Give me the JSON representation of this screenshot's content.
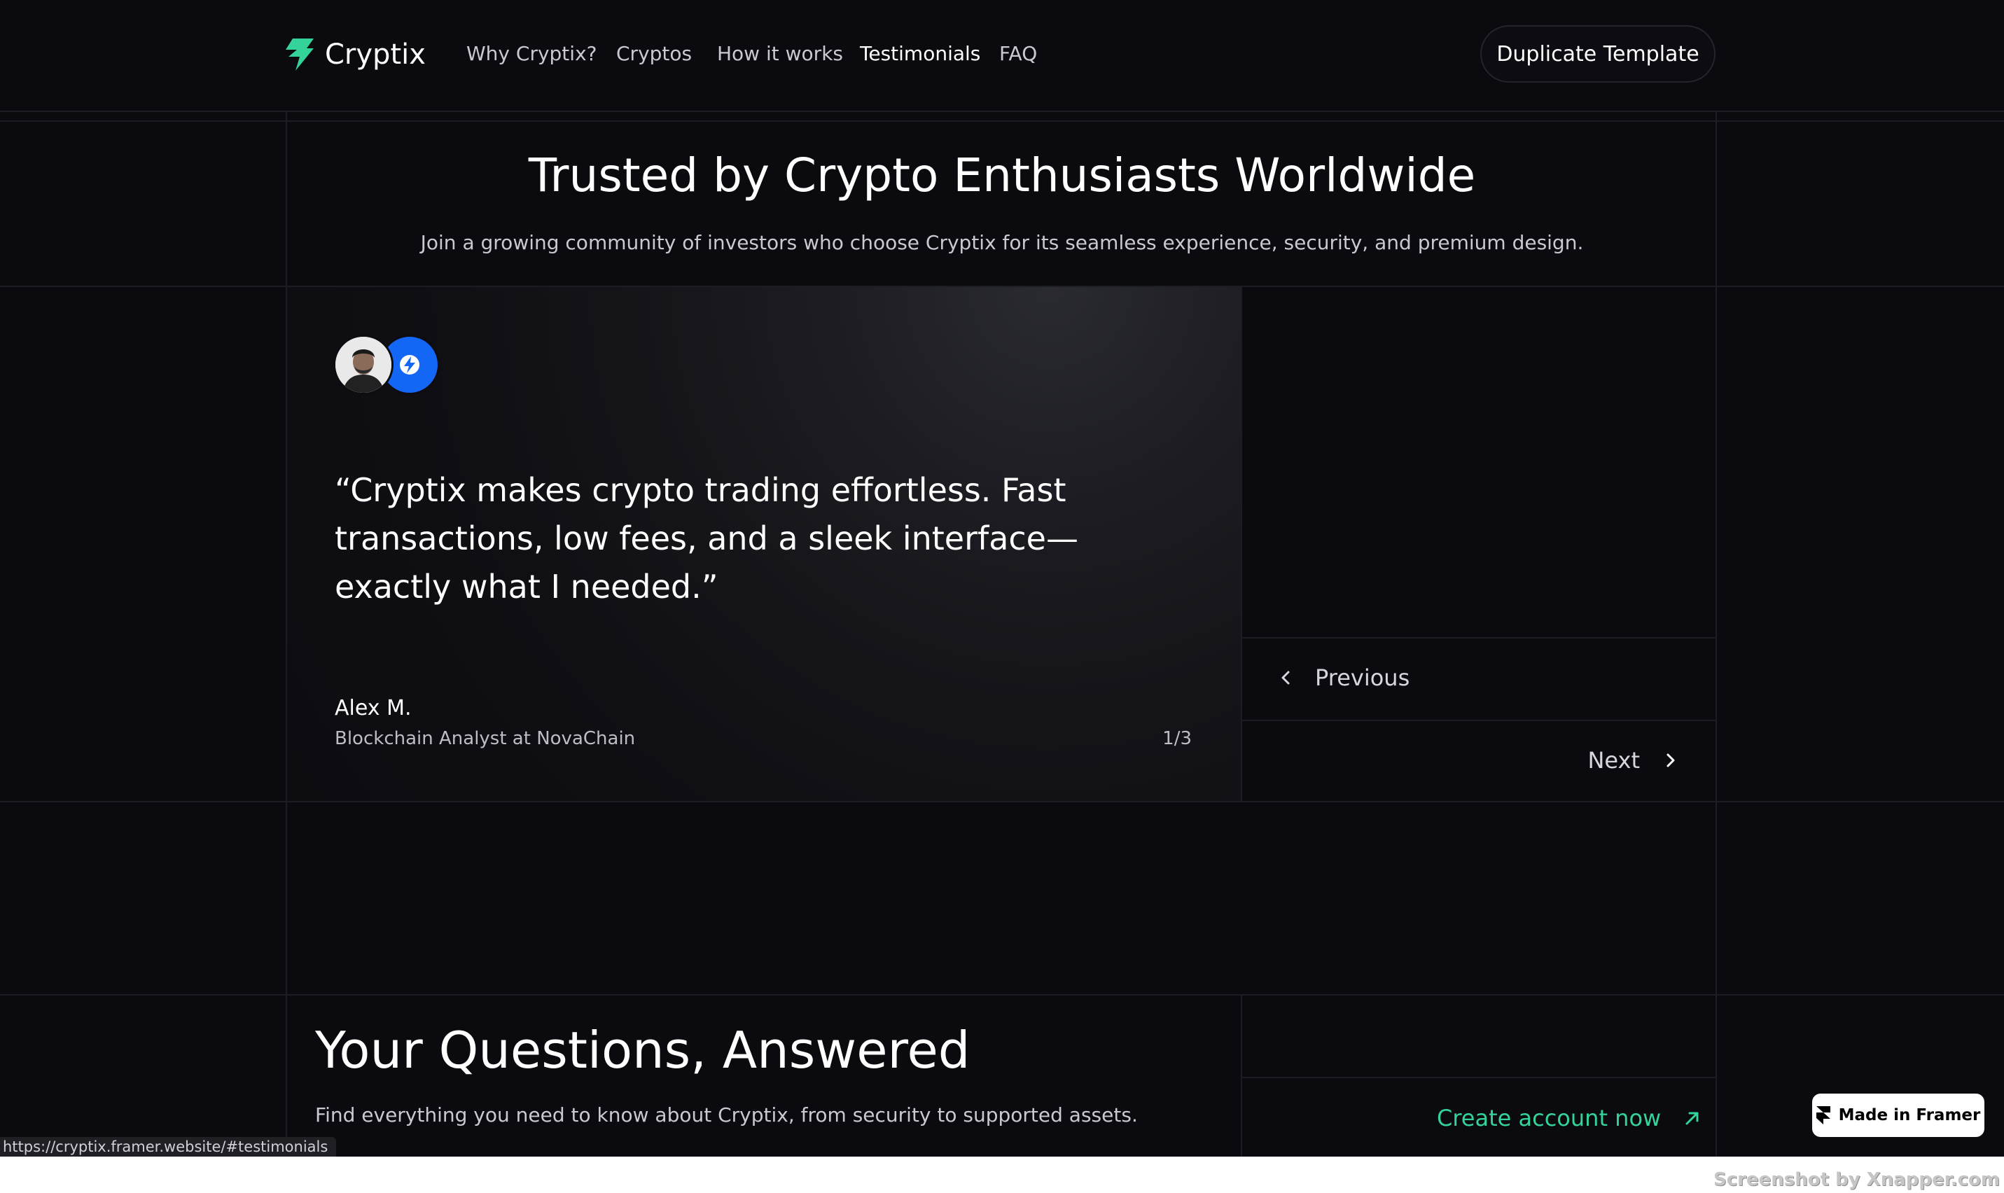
{
  "nav": {
    "brand": "Cryptix",
    "links": [
      "Why Cryptix?",
      "Cryptos",
      "How it works",
      "Testimonials",
      "FAQ"
    ],
    "active_link": "Testimonials",
    "cta": "Duplicate Template"
  },
  "hero": {
    "title": "Trusted by Crypto Enthusiasts Worldwide",
    "subtitle": "Join a growing community of investors who choose Cryptix for its seamless experience, security, and premium design."
  },
  "testimonial": {
    "quote": "“Cryptix makes crypto trading effortless. Fast transactions, low fees, and a sleek interface—exactly what I needed.”",
    "author": "Alex M.",
    "role": "Blockchain Analyst at NovaChain",
    "counter": "1/3",
    "previous_label": "Previous",
    "next_label": "Next"
  },
  "faq": {
    "title": "Your Questions, Answered",
    "subtitle": "Find everything you need to know about Cryptix, from security to supported assets.",
    "cta": "Create account now"
  },
  "status_bar": {
    "url": "https://cryptix.framer.website/#testimonials"
  },
  "badge": {
    "label": "Made in Framer"
  },
  "watermark": "Screenshot by Xnapper.com",
  "colors": {
    "background": "#0a0a0f",
    "accent_green": "#34d399",
    "logo_blue": "#1467f5"
  }
}
